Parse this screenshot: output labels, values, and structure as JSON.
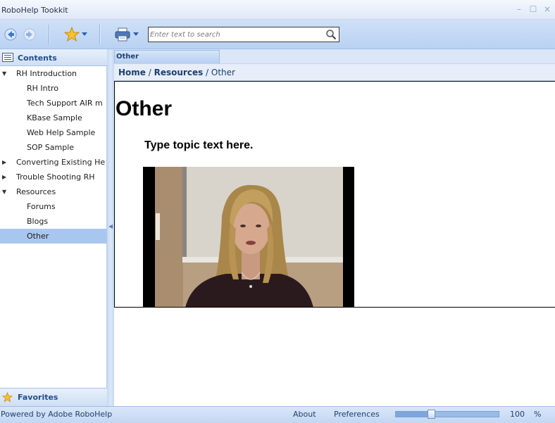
{
  "window": {
    "title": "RoboHelp Tookkit",
    "minimize_glyph": "–",
    "maximize_glyph": "☐",
    "close_glyph": "×"
  },
  "toolbar": {
    "back_icon": "back-arrow-icon",
    "forward_icon": "forward-arrow-icon",
    "favorites_icon": "star-icon",
    "print_icon": "printer-icon",
    "search_placeholder": "Enter text to search",
    "search_value": "",
    "search_icon": "magnifier-icon"
  },
  "sidebar": {
    "contents_label": "Contents",
    "favorites_label": "Favorites",
    "items": [
      {
        "label": "RH Introduction",
        "level": 0,
        "expander": "▼",
        "selected": false
      },
      {
        "label": "RH Intro",
        "level": 1,
        "expander": "",
        "selected": false
      },
      {
        "label": "Tech Support AIR m",
        "level": 1,
        "expander": "",
        "selected": false
      },
      {
        "label": "KBase Sample",
        "level": 1,
        "expander": "",
        "selected": false
      },
      {
        "label": "Web Help Sample",
        "level": 1,
        "expander": "",
        "selected": false
      },
      {
        "label": "SOP Sample",
        "level": 1,
        "expander": "",
        "selected": false
      },
      {
        "label": "Converting Existing He",
        "level": 0,
        "expander": "▶",
        "selected": false
      },
      {
        "label": "Trouble Shooting RH",
        "level": 0,
        "expander": "▶",
        "selected": false
      },
      {
        "label": "Resources",
        "level": 0,
        "expander": "▼",
        "selected": false
      },
      {
        "label": "Forums",
        "level": 1,
        "expander": "",
        "selected": false
      },
      {
        "label": "Blogs",
        "level": 1,
        "expander": "",
        "selected": false
      },
      {
        "label": "Other",
        "level": 1,
        "expander": "",
        "selected": true
      }
    ]
  },
  "content": {
    "tab_label": "Other",
    "breadcrumb": {
      "home": "Home",
      "sep1": " / ",
      "resources": "Resources",
      "sep2": " / ",
      "current": "Other"
    },
    "heading": "Other",
    "paragraph": "Type topic text here."
  },
  "status": {
    "powered_by": "Powered by Adobe RoboHelp",
    "about": "About",
    "preferences": "Preferences",
    "zoom_value": "100",
    "zoom_unit": "%",
    "zoom_slider_fraction": 0.33
  },
  "colors": {
    "accent": "#224d8c",
    "selection": "#a9c6ee",
    "toolbar_bg": "#c4d8f4"
  }
}
